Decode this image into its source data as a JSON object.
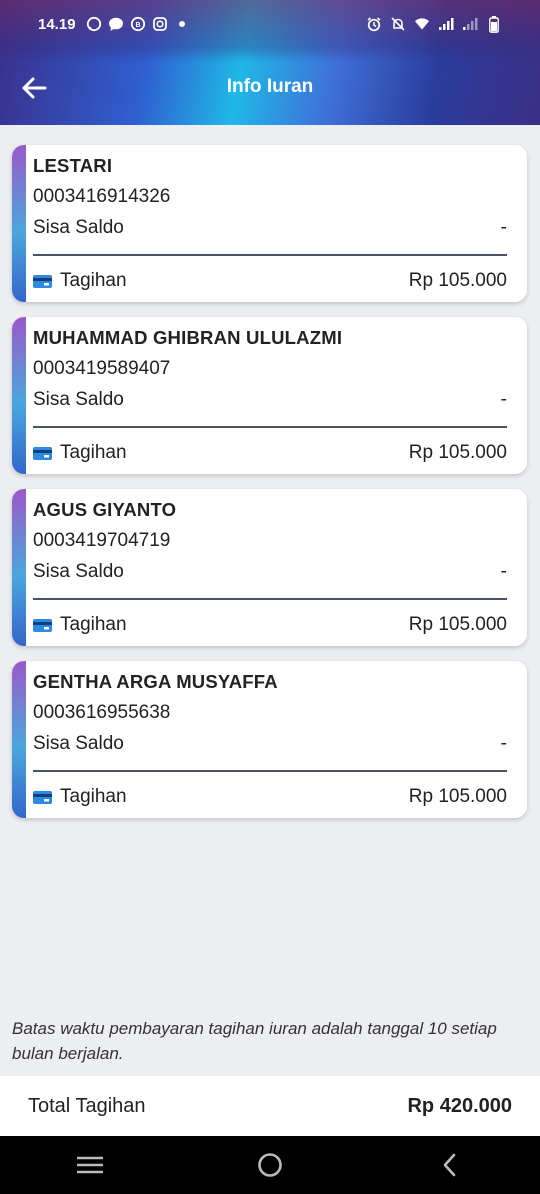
{
  "status_bar": {
    "time": "14.19",
    "left_icons": [
      "whatsapp-icon",
      "chat-icon",
      "whatsapp-business-icon",
      "instagram-icon",
      "dot-icon"
    ],
    "right_icons": [
      "alarm-icon",
      "mute-icon",
      "wifi-icon",
      "signal-icon",
      "signal-weak-icon",
      "battery-icon"
    ]
  },
  "app_bar": {
    "title": "Info Iuran",
    "back_icon": "arrow-left-icon"
  },
  "members": [
    {
      "name": "LESTARI",
      "number": "0003416914326",
      "saldo_label": "Sisa Saldo",
      "saldo_value": "-",
      "bill_label": "Tagihan",
      "bill_amount": "Rp 105.000"
    },
    {
      "name": "MUHAMMAD GHIBRAN ULULAZMI",
      "number": "0003419589407",
      "saldo_label": "Sisa Saldo",
      "saldo_value": "-",
      "bill_label": "Tagihan",
      "bill_amount": "Rp 105.000"
    },
    {
      "name": "AGUS GIYANTO",
      "number": "0003419704719",
      "saldo_label": "Sisa Saldo",
      "saldo_value": "-",
      "bill_label": "Tagihan",
      "bill_amount": "Rp 105.000"
    },
    {
      "name": "GENTHA ARGA MUSYAFFA",
      "number": "0003616955638",
      "saldo_label": "Sisa Saldo",
      "saldo_value": "-",
      "bill_label": "Tagihan",
      "bill_amount": "Rp 105.000"
    }
  ],
  "note": "Batas waktu pembayaran tagihan iuran adalah tanggal 10 setiap bulan berjalan.",
  "total": {
    "label": "Total Tagihan",
    "value": "Rp 420.000"
  },
  "nav_bar": {
    "icons": [
      "recent-apps-icon",
      "home-icon",
      "back-icon"
    ]
  },
  "colors": {
    "accent_top": "#9b59c9",
    "accent_bottom": "#3366cc",
    "background": "#eceef1"
  }
}
